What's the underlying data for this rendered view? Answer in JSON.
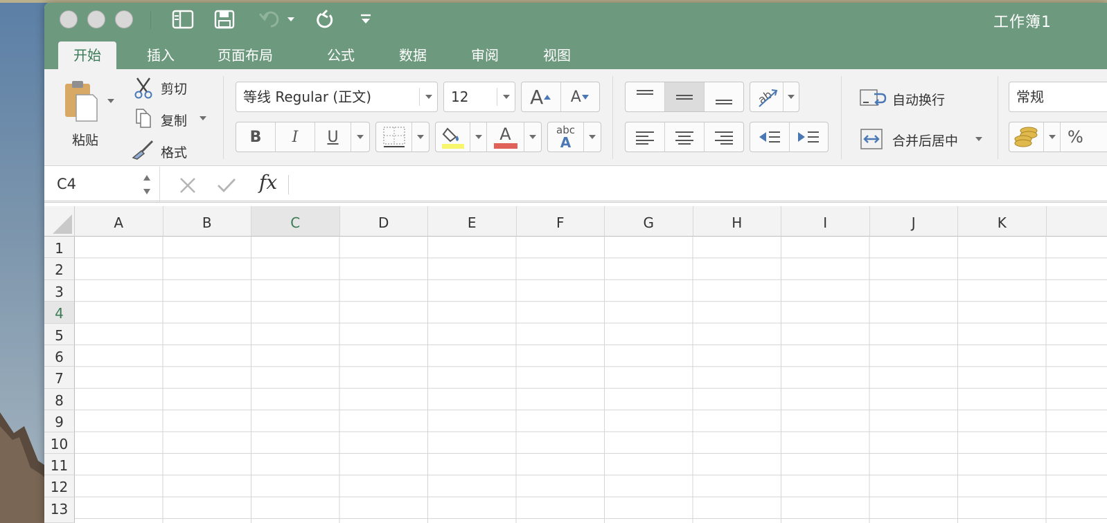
{
  "window": {
    "title": "工作簿1"
  },
  "tabs": [
    {
      "label": "开始",
      "active": true
    },
    {
      "label": "插入"
    },
    {
      "label": "页面布局"
    },
    {
      "label": "公式"
    },
    {
      "label": "数据"
    },
    {
      "label": "审阅"
    },
    {
      "label": "视图"
    }
  ],
  "clipboard": {
    "paste": "粘贴",
    "cut": "剪切",
    "copy": "复制",
    "format": "格式"
  },
  "font": {
    "name": "等线 Regular (正文)",
    "size": "12",
    "bold": "B",
    "italic": "I",
    "underline": "U",
    "color_letter": "A",
    "grow": "A",
    "shrink": "A",
    "phonetic": "abc"
  },
  "alignment": {
    "wrap_text": "自动换行",
    "merge_center": "合并后居中"
  },
  "number": {
    "format": "常规",
    "percent": "%"
  },
  "formula_bar": {
    "cell_ref": "C4",
    "fx": "fx",
    "value": ""
  },
  "grid": {
    "columns": [
      "A",
      "B",
      "C",
      "D",
      "E",
      "F",
      "G",
      "H",
      "I",
      "J",
      "K"
    ],
    "rows": [
      "1",
      "2",
      "3",
      "4",
      "5",
      "6",
      "7",
      "8",
      "9",
      "10",
      "11",
      "12",
      "13"
    ],
    "selected_column": "C",
    "selected_row": "4"
  },
  "colors": {
    "accent": "#6d9a7e",
    "selected_text": "#3b7a57",
    "highlight": "#f7f56b",
    "font_color": "#e0605a"
  }
}
